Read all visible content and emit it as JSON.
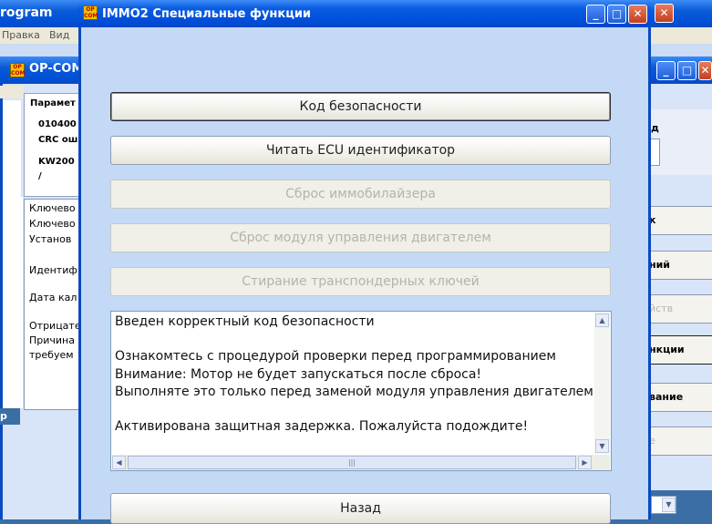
{
  "background_window": {
    "title": "rogram",
    "menu": [
      "Правка",
      "Вид"
    ]
  },
  "opcom_left": {
    "title": "OP-COM",
    "params_label": "Парамет",
    "param_line1": "010400",
    "param_line2": "CRC ош",
    "param_line3": "KW200",
    "param_line4": "/",
    "list": [
      "Ключево",
      "Ключево",
      "Установ",
      "",
      "Идентиф",
      "",
      "Дата кал",
      "",
      "Отрицате",
      "Причина",
      "требуем"
    ],
    "bottom_text": "р"
  },
  "opcom_right": {
    "label_top": "д",
    "buttons": [
      {
        "label": "к",
        "disabled": false
      },
      {
        "label": "ний",
        "disabled": false
      },
      {
        "label": "йств",
        "disabled": true
      },
      {
        "label": "нкции",
        "disabled": false
      },
      {
        "label": "вание",
        "disabled": false
      },
      {
        "label": "е",
        "disabled": true
      }
    ]
  },
  "dialog": {
    "app_icon": "OP COM",
    "title": "IMMO2 Специальные функции",
    "buttons": {
      "security_code": "Код безопасности",
      "read_ecu_id": "Читать ECU идентификатор",
      "reset_immo": "Сброс иммобилайзера",
      "reset_ecm": "Сброс модуля управления двигателем",
      "erase_keys": "Стирание транспондерных ключей",
      "back": "Назад"
    },
    "message_lines": [
      "Введен корректный код безопасности",
      "",
      "Ознакомтесь с процедурой проверки перед программированием",
      "Внимание:  Мотор не будет запускаться после сброса!",
      "Выполняте это только перед заменой модуля управления двигателем!",
      "",
      "Активирована защитная задержка. Пожалуйста подождите!"
    ]
  }
}
